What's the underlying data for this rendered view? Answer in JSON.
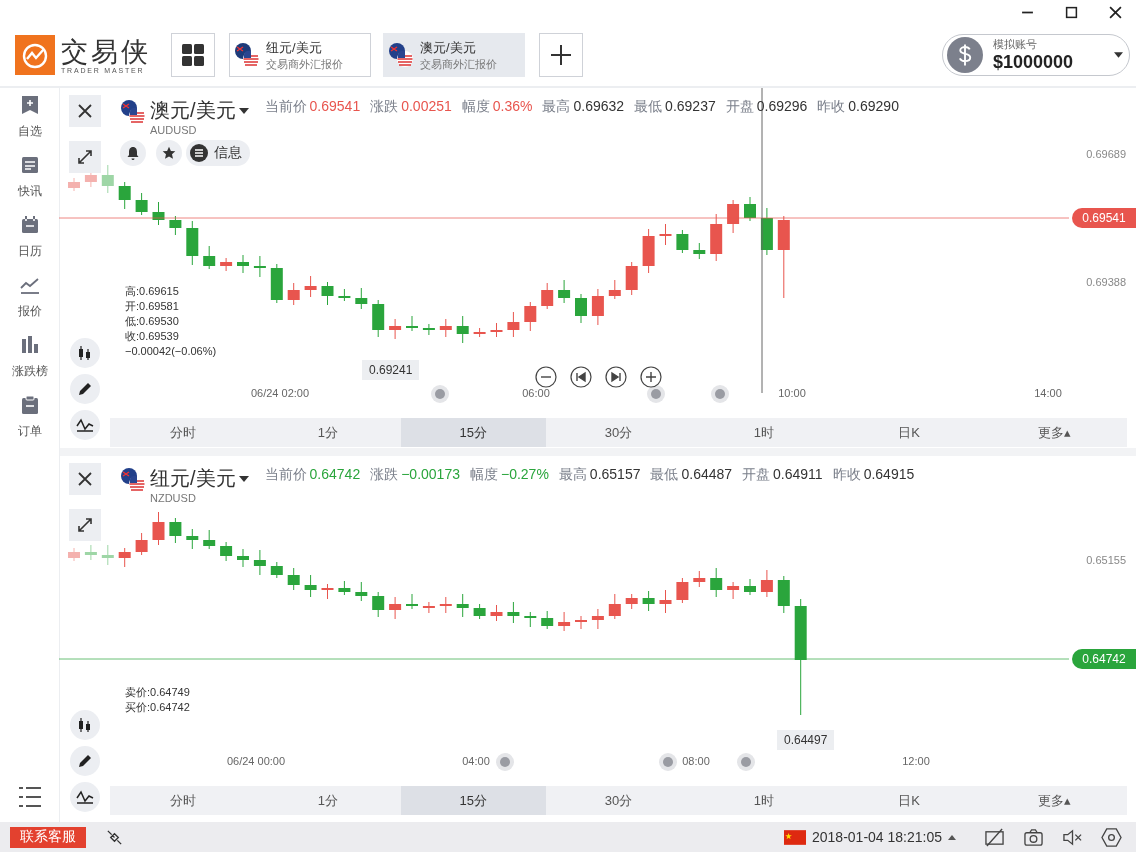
{
  "logo": {
    "name": "交易侠",
    "subtitle": "TRADER MASTER"
  },
  "quote_tabs": [
    {
      "pair": "纽元/美元",
      "subtitle": "交易商外汇报价",
      "selected": false
    },
    {
      "pair": "澳元/美元",
      "subtitle": "交易商外汇报价",
      "selected": true
    }
  ],
  "account": {
    "label": "模拟账号",
    "balance": "$1000000"
  },
  "sidebar": {
    "items": [
      {
        "label": "自选"
      },
      {
        "label": "快讯"
      },
      {
        "label": "日历"
      },
      {
        "label": "报价"
      },
      {
        "label": "涨跌榜"
      },
      {
        "label": "订单"
      }
    ]
  },
  "panels": [
    {
      "pair": "澳元/美元",
      "code": "AUDUSD",
      "color": "#e8554e",
      "quotes": [
        {
          "label": "当前价",
          "value": "0.69541",
          "color": "#e8554e"
        },
        {
          "label": "涨跌",
          "value": "0.00251",
          "color": "#e8554e"
        },
        {
          "label": "幅度",
          "value": "0.36%",
          "color": "#e8554e"
        },
        {
          "label": "最高",
          "value": "0.69632",
          "color": "#333333"
        },
        {
          "label": "最低",
          "value": "0.69237",
          "color": "#333333"
        },
        {
          "label": "开盘",
          "value": "0.69296",
          "color": "#333333"
        },
        {
          "label": "昨收",
          "value": "0.69290",
          "color": "#333333"
        }
      ],
      "actions": {
        "info_label": "信息"
      },
      "overlay_lines": [
        "高:0.69615",
        "开:0.69581",
        "低:0.69530",
        "收:0.69539",
        "−0.00042(−0.06%)"
      ],
      "price_labels": [
        "0.69689",
        "0.69388"
      ],
      "current_price": "0.69541",
      "low_tooltip": "0.69241",
      "zoom_controls": true,
      "time_labels": [
        "06/24 02:00",
        "06:00",
        "10:00",
        "14:00"
      ],
      "periods": [
        {
          "label": "分时",
          "selected": false
        },
        {
          "label": "1分",
          "selected": false
        },
        {
          "label": "15分",
          "selected": true
        },
        {
          "label": "30分",
          "selected": false
        },
        {
          "label": "1时",
          "selected": false
        },
        {
          "label": "日K",
          "selected": false
        },
        {
          "label": "更多▴",
          "selected": false
        }
      ]
    },
    {
      "pair": "纽元/美元",
      "code": "NZDUSD",
      "color": "#2aa53c",
      "quotes": [
        {
          "label": "当前价",
          "value": "0.64742",
          "color": "#2aa53c"
        },
        {
          "label": "涨跌",
          "value": "−0.00173",
          "color": "#2aa53c"
        },
        {
          "label": "幅度",
          "value": "−0.27%",
          "color": "#2aa53c"
        },
        {
          "label": "最高",
          "value": "0.65157",
          "color": "#333333"
        },
        {
          "label": "最低",
          "value": "0.64487",
          "color": "#333333"
        },
        {
          "label": "开盘",
          "value": "0.64911",
          "color": "#333333"
        },
        {
          "label": "昨收",
          "value": "0.64915",
          "color": "#333333"
        }
      ],
      "overlay_lines": [
        "卖价:0.64749",
        "买价:0.64742"
      ],
      "price_labels": [
        "0.65155"
      ],
      "current_price": "0.64742",
      "low_tooltip": "0.64497",
      "zoom_controls": false,
      "time_labels": [
        "06/24 00:00",
        "04:00",
        "08:00",
        "12:00"
      ],
      "periods": [
        {
          "label": "分时",
          "selected": false
        },
        {
          "label": "1分",
          "selected": false
        },
        {
          "label": "15分",
          "selected": true
        },
        {
          "label": "30分",
          "selected": false
        },
        {
          "label": "1时",
          "selected": false
        },
        {
          "label": "日K",
          "selected": false
        },
        {
          "label": "更多▴",
          "selected": false
        }
      ]
    }
  ],
  "status_bar": {
    "support_button": "联系客服",
    "datetime": "2018-01-04 18:21:05"
  }
}
